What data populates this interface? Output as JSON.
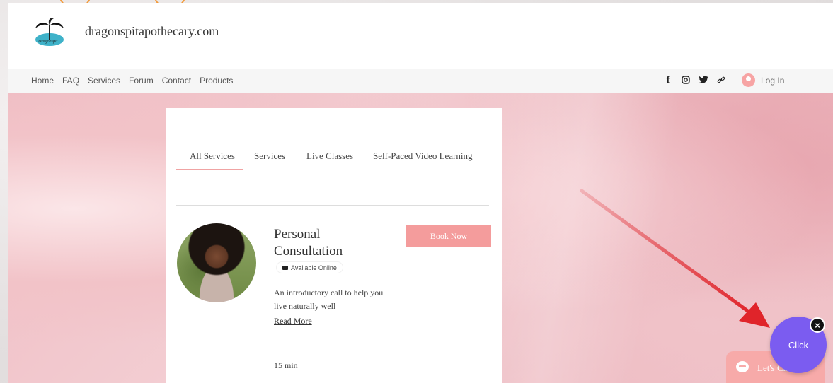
{
  "header": {
    "site_name": "dragonspitapothecary.com",
    "logo_text": "Dragonspit"
  },
  "nav": {
    "links": [
      "Home",
      "FAQ",
      "Services",
      "Forum",
      "Contact",
      "Products"
    ],
    "social_icons": [
      "facebook-icon",
      "instagram-icon",
      "twitter-icon",
      "link-icon"
    ],
    "login_label": "Log In"
  },
  "services": {
    "tabs": [
      "All Services",
      "Services",
      "Live Classes",
      "Self-Paced Video Learning"
    ],
    "active_tab": "All Services",
    "item": {
      "title": "Personal Consultation",
      "badge": "Available Online",
      "description": "An introductory call to help you live naturally well",
      "read_more": "Read More",
      "duration": "15 min",
      "book_label": "Book Now"
    }
  },
  "chat": {
    "label": "Let's Chat!",
    "click_label": "Click",
    "close_symbol": "×"
  },
  "colors": {
    "accent_pink": "#f49c9c",
    "chat_purple": "#7b5cf0",
    "arrow_red": "#e0242a"
  }
}
